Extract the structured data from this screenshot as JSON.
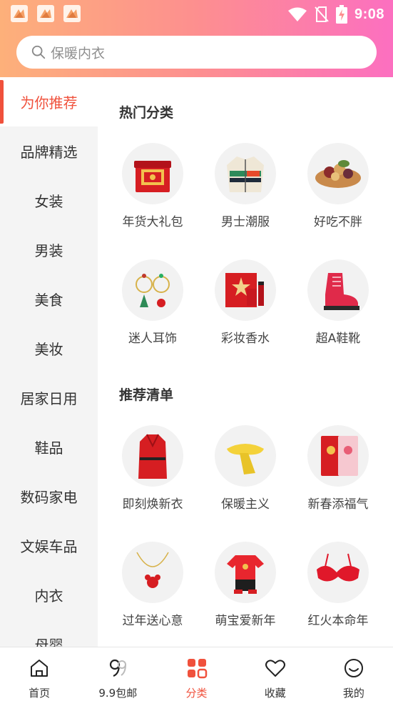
{
  "status_bar": {
    "time": "9:08",
    "icons": [
      "app-notification-icon",
      "app-notification-icon",
      "app-notification-icon",
      "wifi-icon",
      "no-sim-icon",
      "battery-charging-icon"
    ]
  },
  "search": {
    "placeholder": "保暖内衣"
  },
  "sidebar": {
    "items": [
      {
        "label": "为你推荐",
        "active": true
      },
      {
        "label": "品牌精选"
      },
      {
        "label": "女装"
      },
      {
        "label": "男装"
      },
      {
        "label": "美食"
      },
      {
        "label": "美妆"
      },
      {
        "label": "居家日用"
      },
      {
        "label": "鞋品"
      },
      {
        "label": "数码家电"
      },
      {
        "label": "文娱车品"
      },
      {
        "label": "内衣"
      },
      {
        "label": "母婴"
      }
    ]
  },
  "sections": [
    {
      "title": "热门分类",
      "items": [
        {
          "label": "年货大礼包",
          "icon": "gift-box-icon"
        },
        {
          "label": "男士潮服",
          "icon": "jacket-icon"
        },
        {
          "label": "好吃不胖",
          "icon": "nuts-bowl-icon"
        },
        {
          "label": "迷人耳饰",
          "icon": "earrings-icon"
        },
        {
          "label": "彩妆香水",
          "icon": "perfume-set-icon"
        },
        {
          "label": "超A鞋靴",
          "icon": "boot-icon"
        }
      ]
    },
    {
      "title": "推荐清单",
      "items": [
        {
          "label": "即刻焕新衣",
          "icon": "red-coat-icon"
        },
        {
          "label": "保暖主义",
          "icon": "scarf-icon"
        },
        {
          "label": "新春添福气",
          "icon": "red-envelope-icon"
        },
        {
          "label": "过年送心意",
          "icon": "necklace-icon"
        },
        {
          "label": "萌宝爱新年",
          "icon": "baby-outfit-icon"
        },
        {
          "label": "红火本命年",
          "icon": "red-bra-icon"
        }
      ]
    }
  ],
  "tabbar": {
    "tabs": [
      {
        "label": "首页",
        "icon": "home-icon"
      },
      {
        "label": "9.9包邮",
        "icon": "nine-nine-icon"
      },
      {
        "label": "分类",
        "icon": "category-grid-icon",
        "active": true
      },
      {
        "label": "收藏",
        "icon": "heart-icon"
      },
      {
        "label": "我的",
        "icon": "smile-face-icon"
      }
    ]
  },
  "colors": {
    "accent": "#f0513c",
    "header_gradient_start": "#fdb07a",
    "header_gradient_end": "#fc6fc0",
    "sidebar_bg": "#f4f4f4"
  }
}
